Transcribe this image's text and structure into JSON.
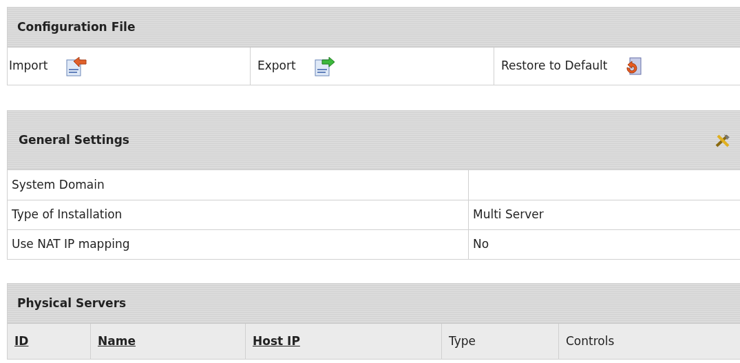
{
  "configuration_file": {
    "title": "Configuration File",
    "actions": [
      {
        "label": "Import",
        "kind": "import"
      },
      {
        "label": "Export",
        "kind": "export"
      },
      {
        "label": "Restore to Default",
        "kind": "restore"
      }
    ]
  },
  "general_settings": {
    "title": "General Settings",
    "rows": [
      {
        "label": "System Domain"
      },
      {
        "label": "Type of Installation",
        "value": "Multi Server"
      },
      {
        "label": "Use NAT IP mapping",
        "value": "No"
      }
    ]
  },
  "physical_servers": {
    "title": "Physical Servers",
    "columns": [
      {
        "label": "ID",
        "sortable": true
      },
      {
        "label": "Name",
        "sortable": true
      },
      {
        "label": "Host IP",
        "sortable": true
      },
      {
        "label": "Type",
        "sortable": false
      },
      {
        "label": "Controls",
        "sortable": false
      }
    ]
  }
}
